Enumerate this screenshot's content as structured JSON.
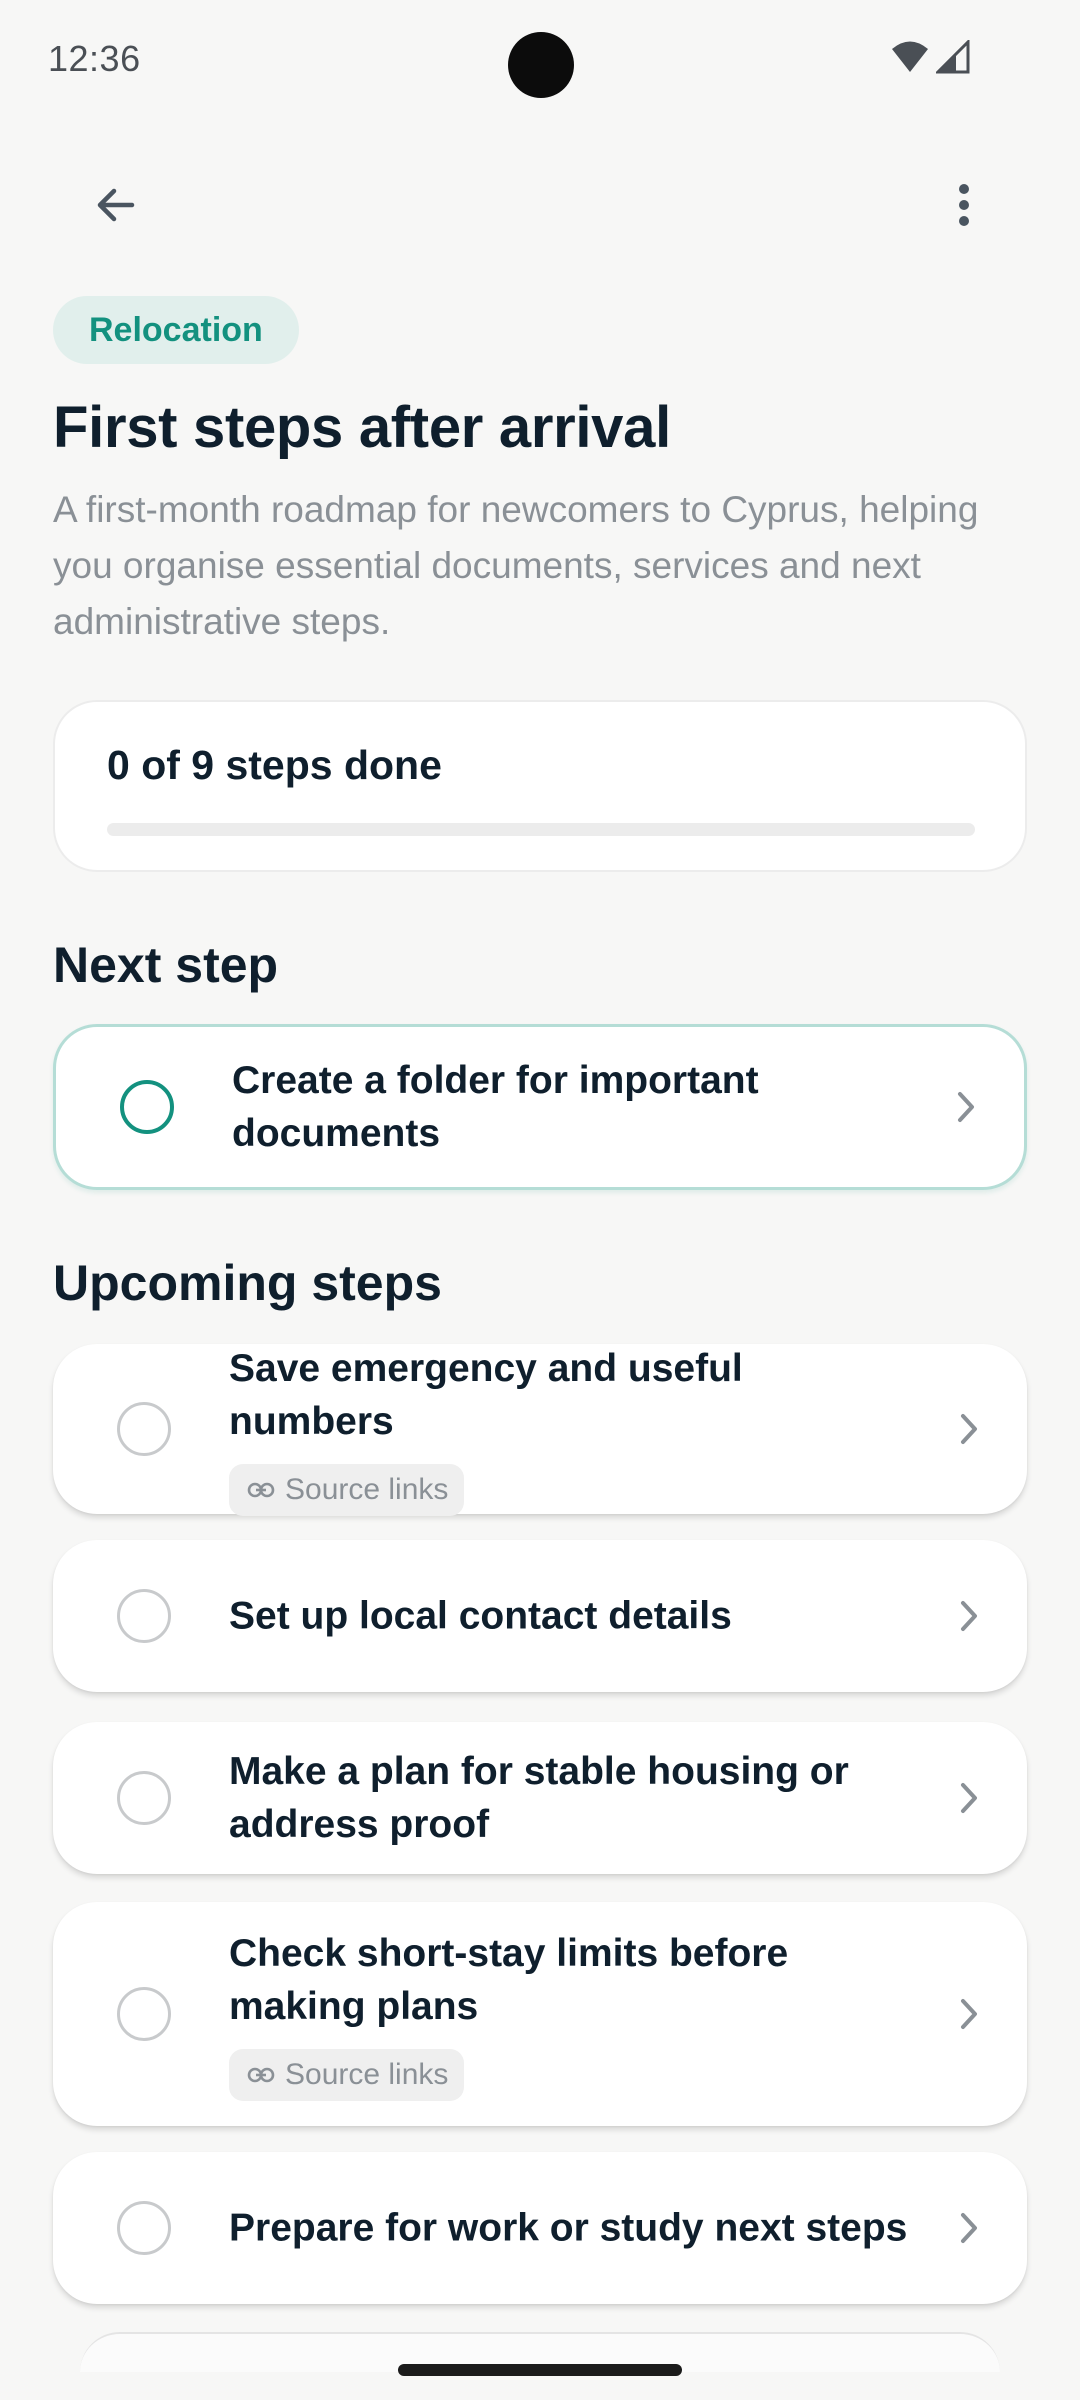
{
  "status_bar": {
    "time": "12:36",
    "icons": [
      "wifi-icon",
      "cellular-signal-icon"
    ]
  },
  "top_bar": {
    "icons": [
      "back-arrow-icon",
      "more-vert-icon"
    ]
  },
  "header": {
    "chip": "Relocation",
    "title": "First steps after arrival",
    "description": "A first-month roadmap for newcomers to Cyprus, helping you organise essential documents, services and next administrative steps."
  },
  "progress": {
    "label": "0 of 9 steps done",
    "completed": 0,
    "total": 9
  },
  "next_step": {
    "heading": "Next step",
    "step": {
      "title": "Create a folder for important documents"
    }
  },
  "upcoming": {
    "heading": "Upcoming steps",
    "steps": [
      {
        "title": "Save emergency and useful numbers",
        "source_label": "Source links"
      },
      {
        "title": "Set up local contact details"
      },
      {
        "title": "Make a plan for stable housing or address proof"
      },
      {
        "title": "Check short-stay limits before making plans",
        "source_label": "Source links"
      },
      {
        "title": "Prepare for work or study next steps"
      }
    ]
  },
  "colors": {
    "accent": "#13917f",
    "chip_bg": "#e1efec",
    "background": "#f7f7f6",
    "text_primary": "#0f1f2d",
    "text_secondary": "#8a9096"
  }
}
